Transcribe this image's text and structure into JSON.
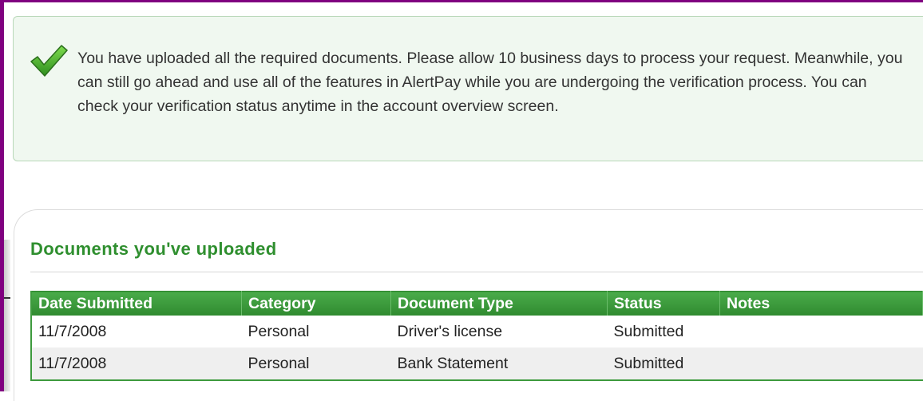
{
  "notice": {
    "icon": "checkmark-icon",
    "message": "You have uploaded all the required documents. Please allow 10 business days to process your request. Meanwhile, you can still go ahead and use all of the features in AlertPay while you are undergoing the verification process. You can check your verification status anytime in the account overview screen."
  },
  "documents": {
    "title": "Documents you've uploaded",
    "columns": [
      "Date Submitted",
      "Category",
      "Document Type",
      "Status",
      "Notes"
    ],
    "rows": [
      {
        "date": "11/7/2008",
        "category": "Personal",
        "type": "Driver's license",
        "status": "Submitted",
        "notes": ""
      },
      {
        "date": "11/7/2008",
        "category": "Personal",
        "type": "Bank Statement",
        "status": "Submitted",
        "notes": ""
      }
    ]
  },
  "colors": {
    "frame": "#800080",
    "accent_green": "#2f8f2f",
    "header_green": "#3d9a3d",
    "notice_bg": "#f0f8f0"
  }
}
